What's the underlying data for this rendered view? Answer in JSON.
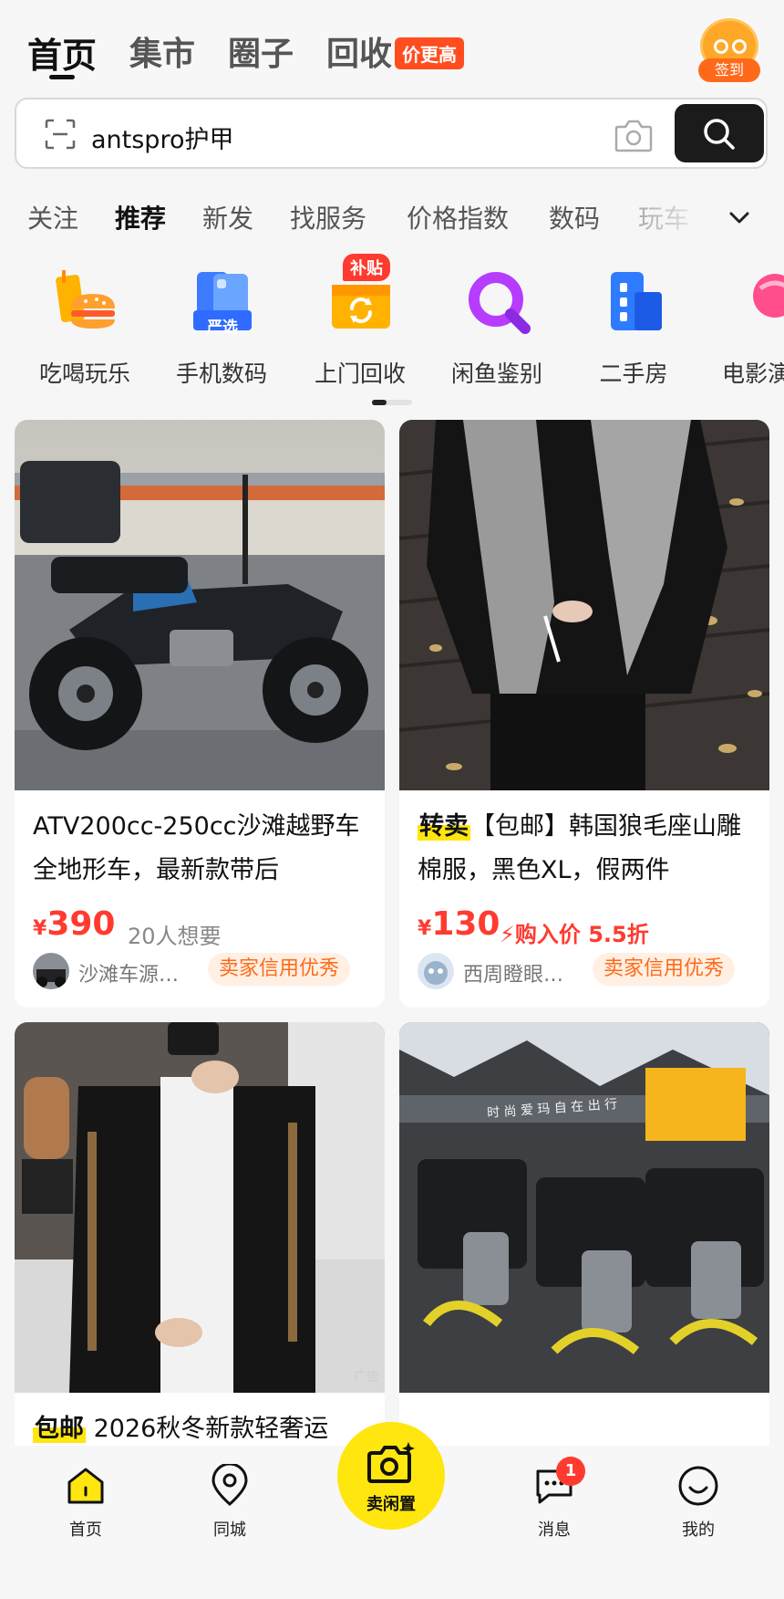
{
  "top_tabs": [
    {
      "label": "首页",
      "active": true
    },
    {
      "label": "集市"
    },
    {
      "label": "圈子"
    },
    {
      "label": "回收"
    }
  ],
  "recycle_badge": "价更高",
  "signin_label": "签到",
  "search": {
    "query": "antspro护甲"
  },
  "categories": [
    "关注",
    "推荐",
    "新发",
    "找服务",
    "价格指数",
    "数码",
    "玩车"
  ],
  "active_category": "推荐",
  "services": [
    {
      "label": "吃喝玩乐",
      "icon": "food-icon"
    },
    {
      "label": "手机数码",
      "icon": "phone-icon",
      "tag": "严选"
    },
    {
      "label": "上门回收",
      "icon": "recycle-box-icon",
      "badge": "补贴"
    },
    {
      "label": "闲鱼鉴别",
      "icon": "magnifier-icon"
    },
    {
      "label": "二手房",
      "icon": "building-icon"
    },
    {
      "label": "电影演",
      "icon": "lollipop-icon"
    }
  ],
  "products": [
    {
      "title": "ATV200cc-250cc沙滩越野车全地形车，最新款带后",
      "price_symbol": "¥",
      "price": "390",
      "want_count": "20人想要",
      "seller": "沙滩车源…",
      "credit": "卖家信用优秀"
    },
    {
      "highlight": "转卖",
      "title": "【包邮】韩国狼毛座山雕棉服，黑色XL，假两件",
      "price_symbol": "¥",
      "price": "130",
      "buy_price": "购入价 5.5折",
      "seller": "西周瞪眼…",
      "credit": "卖家信用优秀"
    },
    {
      "highlight": "包邮",
      "title": "2026秋冬新款轻奢运",
      "ad_tag": "广告"
    },
    {
      "image_text": "时 尚 爱 玛  自 在 出 行"
    }
  ],
  "bottom_nav": {
    "home": "首页",
    "nearby": "同城",
    "publish": "卖闲置",
    "messages": "消息",
    "messages_badge": "1",
    "profile": "我的"
  },
  "colors": {
    "accent_yellow": "#ffe60f",
    "price_red": "#ff3b30",
    "credit_orange": "#ff6a1a"
  }
}
